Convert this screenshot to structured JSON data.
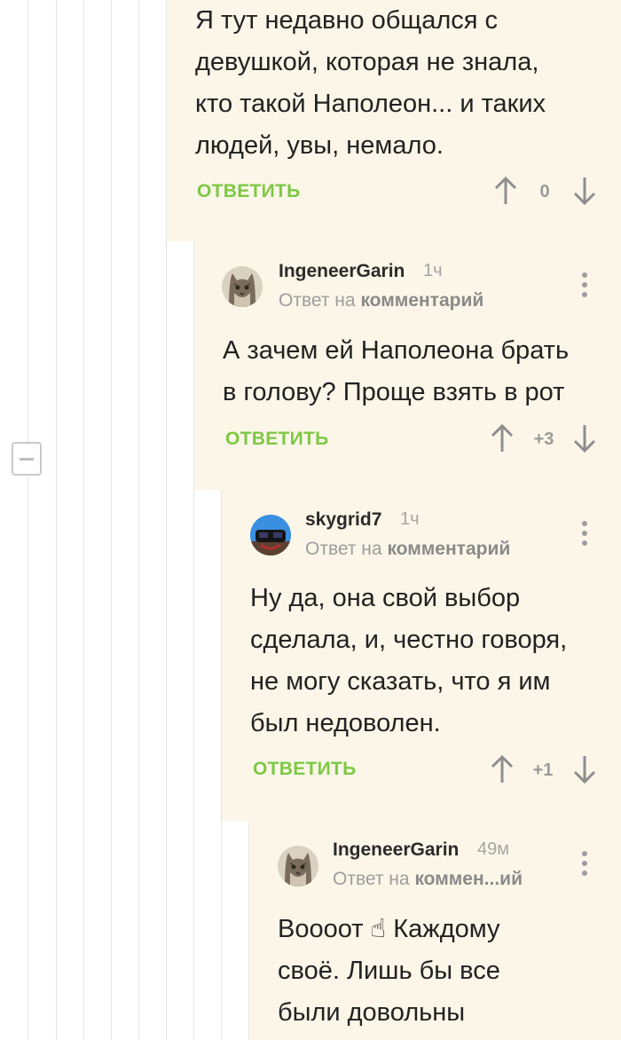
{
  "comments": [
    {
      "text": "Я тут недавно общался с\nдевушкой, которая не знала,\nкто такой Наполеон... и таких\nлюдей, увы, немало.",
      "reply_label": "ОТВЕТИТЬ",
      "score": "0"
    },
    {
      "username": "IngeneerGarin",
      "time": "1ч",
      "reply_to_prefix": "Ответ на",
      "reply_to_target": "комментарий",
      "text": "А зачем ей Наполеона брать\nв голову? Проще взять в рот",
      "reply_label": "ОТВЕТИТЬ",
      "score": "+3",
      "avatar_icon": "cat-avatar-icon"
    },
    {
      "username": "skygrid7",
      "time": "1ч",
      "reply_to_prefix": "Ответ на",
      "reply_to_target": "комментарий",
      "text": "Ну да, она свой выбор\nсделала, и, честно говоря,\nне могу сказать, что я им\nбыл недоволен.",
      "reply_label": "ОТВЕТИТЬ",
      "score": "+1",
      "avatar_icon": "vr-headset-avatar-icon"
    },
    {
      "username": "IngeneerGarin",
      "time": "49м",
      "reply_to_prefix": "Ответ на",
      "reply_to_target": "коммен...ий",
      "text": "Воооот ☝ Каждому\nсвоё. Лишь бы все\nбыли довольны",
      "avatar_icon": "cat-avatar-icon"
    }
  ],
  "colors": {
    "accent_green": "#7ec845",
    "comment_bg": "#fbf6e8",
    "muted_text": "#9d9d9d"
  },
  "icons": [
    "collapse-thread-icon",
    "upvote-arrow-icon",
    "downvote-arrow-icon",
    "more-options-icon"
  ]
}
